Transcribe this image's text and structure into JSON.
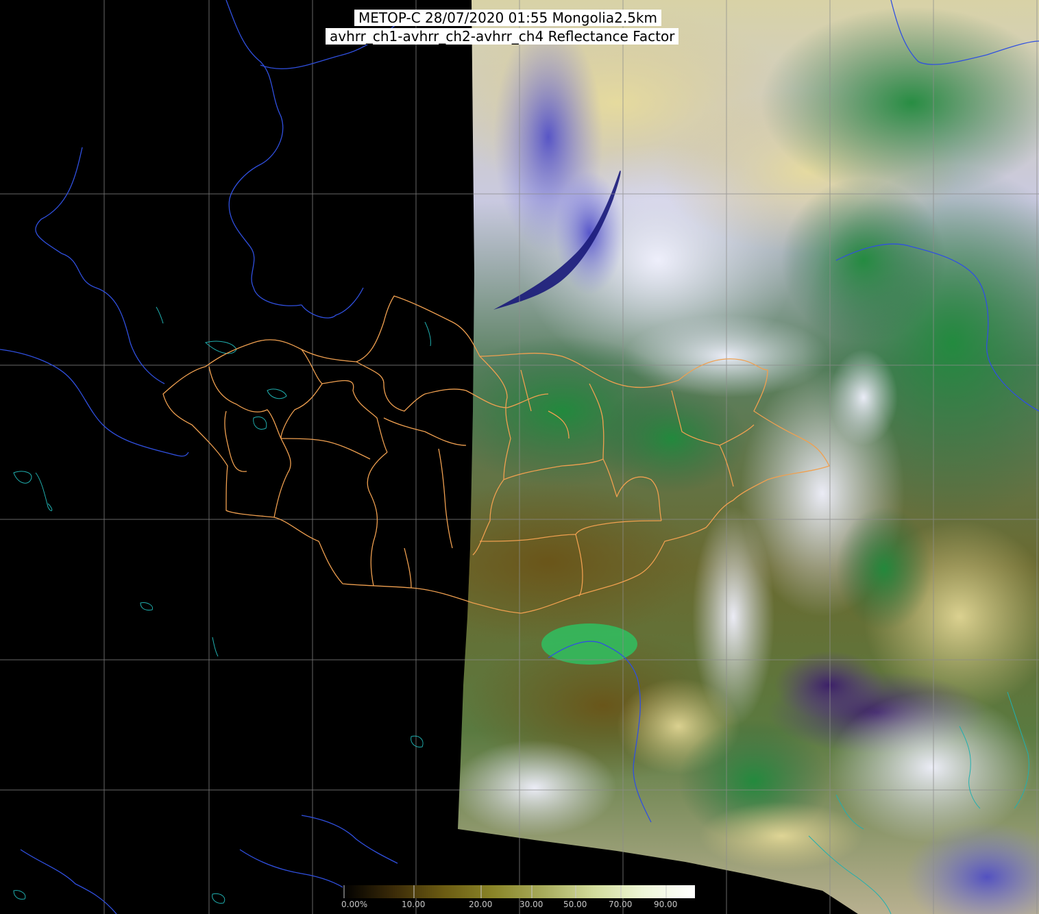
{
  "title": {
    "line1": "METOP-C 28/07/2020 01:55 Mongolia2.5km",
    "line2": "avhrr_ch1-avhrr_ch2-avhrr_ch4 Reflectance Factor"
  },
  "colorbar": {
    "tick_labels": [
      "0.00%",
      "10.00",
      "20.00",
      "30.00",
      "50.00",
      "70.00",
      "90.00"
    ],
    "gradient_colors": [
      "#000000",
      "#3a2a08",
      "#6b5b12",
      "#8a8528",
      "#a8ac5c",
      "#d2dc9c",
      "#eef6d8",
      "#ffffff"
    ]
  },
  "colors": {
    "background": "#000000",
    "grid": "#8c8c8c",
    "admin_borders": "#f0a050",
    "rivers": "#3050e0",
    "coast_lakes": "#20b0b0"
  }
}
